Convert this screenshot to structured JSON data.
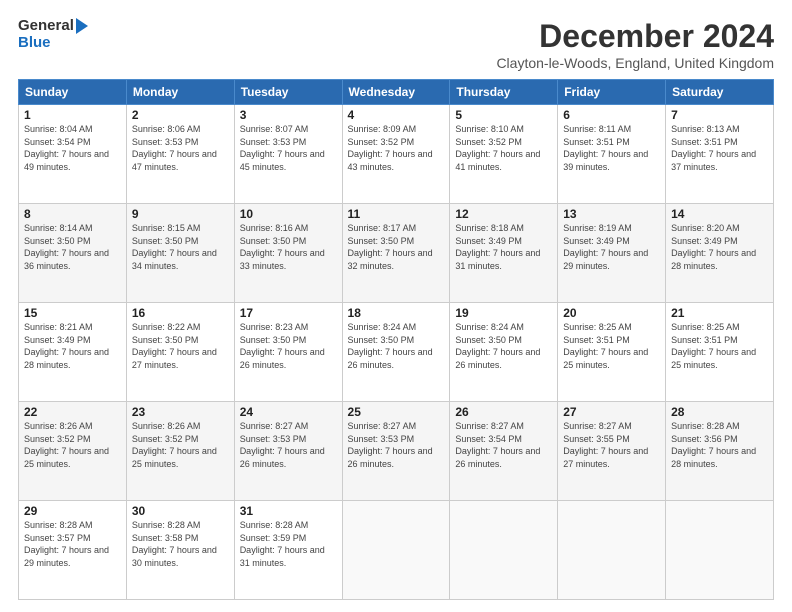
{
  "logo": {
    "line1": "General",
    "line2": "Blue"
  },
  "title": "December 2024",
  "location": "Clayton-le-Woods, England, United Kingdom",
  "days_of_week": [
    "Sunday",
    "Monday",
    "Tuesday",
    "Wednesday",
    "Thursday",
    "Friday",
    "Saturday"
  ],
  "weeks": [
    [
      {
        "day": "1",
        "sunrise": "Sunrise: 8:04 AM",
        "sunset": "Sunset: 3:54 PM",
        "daylight": "Daylight: 7 hours and 49 minutes."
      },
      {
        "day": "2",
        "sunrise": "Sunrise: 8:06 AM",
        "sunset": "Sunset: 3:53 PM",
        "daylight": "Daylight: 7 hours and 47 minutes."
      },
      {
        "day": "3",
        "sunrise": "Sunrise: 8:07 AM",
        "sunset": "Sunset: 3:53 PM",
        "daylight": "Daylight: 7 hours and 45 minutes."
      },
      {
        "day": "4",
        "sunrise": "Sunrise: 8:09 AM",
        "sunset": "Sunset: 3:52 PM",
        "daylight": "Daylight: 7 hours and 43 minutes."
      },
      {
        "day": "5",
        "sunrise": "Sunrise: 8:10 AM",
        "sunset": "Sunset: 3:52 PM",
        "daylight": "Daylight: 7 hours and 41 minutes."
      },
      {
        "day": "6",
        "sunrise": "Sunrise: 8:11 AM",
        "sunset": "Sunset: 3:51 PM",
        "daylight": "Daylight: 7 hours and 39 minutes."
      },
      {
        "day": "7",
        "sunrise": "Sunrise: 8:13 AM",
        "sunset": "Sunset: 3:51 PM",
        "daylight": "Daylight: 7 hours and 37 minutes."
      }
    ],
    [
      {
        "day": "8",
        "sunrise": "Sunrise: 8:14 AM",
        "sunset": "Sunset: 3:50 PM",
        "daylight": "Daylight: 7 hours and 36 minutes."
      },
      {
        "day": "9",
        "sunrise": "Sunrise: 8:15 AM",
        "sunset": "Sunset: 3:50 PM",
        "daylight": "Daylight: 7 hours and 34 minutes."
      },
      {
        "day": "10",
        "sunrise": "Sunrise: 8:16 AM",
        "sunset": "Sunset: 3:50 PM",
        "daylight": "Daylight: 7 hours and 33 minutes."
      },
      {
        "day": "11",
        "sunrise": "Sunrise: 8:17 AM",
        "sunset": "Sunset: 3:50 PM",
        "daylight": "Daylight: 7 hours and 32 minutes."
      },
      {
        "day": "12",
        "sunrise": "Sunrise: 8:18 AM",
        "sunset": "Sunset: 3:49 PM",
        "daylight": "Daylight: 7 hours and 31 minutes."
      },
      {
        "day": "13",
        "sunrise": "Sunrise: 8:19 AM",
        "sunset": "Sunset: 3:49 PM",
        "daylight": "Daylight: 7 hours and 29 minutes."
      },
      {
        "day": "14",
        "sunrise": "Sunrise: 8:20 AM",
        "sunset": "Sunset: 3:49 PM",
        "daylight": "Daylight: 7 hours and 28 minutes."
      }
    ],
    [
      {
        "day": "15",
        "sunrise": "Sunrise: 8:21 AM",
        "sunset": "Sunset: 3:49 PM",
        "daylight": "Daylight: 7 hours and 28 minutes."
      },
      {
        "day": "16",
        "sunrise": "Sunrise: 8:22 AM",
        "sunset": "Sunset: 3:50 PM",
        "daylight": "Daylight: 7 hours and 27 minutes."
      },
      {
        "day": "17",
        "sunrise": "Sunrise: 8:23 AM",
        "sunset": "Sunset: 3:50 PM",
        "daylight": "Daylight: 7 hours and 26 minutes."
      },
      {
        "day": "18",
        "sunrise": "Sunrise: 8:24 AM",
        "sunset": "Sunset: 3:50 PM",
        "daylight": "Daylight: 7 hours and 26 minutes."
      },
      {
        "day": "19",
        "sunrise": "Sunrise: 8:24 AM",
        "sunset": "Sunset: 3:50 PM",
        "daylight": "Daylight: 7 hours and 26 minutes."
      },
      {
        "day": "20",
        "sunrise": "Sunrise: 8:25 AM",
        "sunset": "Sunset: 3:51 PM",
        "daylight": "Daylight: 7 hours and 25 minutes."
      },
      {
        "day": "21",
        "sunrise": "Sunrise: 8:25 AM",
        "sunset": "Sunset: 3:51 PM",
        "daylight": "Daylight: 7 hours and 25 minutes."
      }
    ],
    [
      {
        "day": "22",
        "sunrise": "Sunrise: 8:26 AM",
        "sunset": "Sunset: 3:52 PM",
        "daylight": "Daylight: 7 hours and 25 minutes."
      },
      {
        "day": "23",
        "sunrise": "Sunrise: 8:26 AM",
        "sunset": "Sunset: 3:52 PM",
        "daylight": "Daylight: 7 hours and 25 minutes."
      },
      {
        "day": "24",
        "sunrise": "Sunrise: 8:27 AM",
        "sunset": "Sunset: 3:53 PM",
        "daylight": "Daylight: 7 hours and 26 minutes."
      },
      {
        "day": "25",
        "sunrise": "Sunrise: 8:27 AM",
        "sunset": "Sunset: 3:53 PM",
        "daylight": "Daylight: 7 hours and 26 minutes."
      },
      {
        "day": "26",
        "sunrise": "Sunrise: 8:27 AM",
        "sunset": "Sunset: 3:54 PM",
        "daylight": "Daylight: 7 hours and 26 minutes."
      },
      {
        "day": "27",
        "sunrise": "Sunrise: 8:27 AM",
        "sunset": "Sunset: 3:55 PM",
        "daylight": "Daylight: 7 hours and 27 minutes."
      },
      {
        "day": "28",
        "sunrise": "Sunrise: 8:28 AM",
        "sunset": "Sunset: 3:56 PM",
        "daylight": "Daylight: 7 hours and 28 minutes."
      }
    ],
    [
      {
        "day": "29",
        "sunrise": "Sunrise: 8:28 AM",
        "sunset": "Sunset: 3:57 PM",
        "daylight": "Daylight: 7 hours and 29 minutes."
      },
      {
        "day": "30",
        "sunrise": "Sunrise: 8:28 AM",
        "sunset": "Sunset: 3:58 PM",
        "daylight": "Daylight: 7 hours and 30 minutes."
      },
      {
        "day": "31",
        "sunrise": "Sunrise: 8:28 AM",
        "sunset": "Sunset: 3:59 PM",
        "daylight": "Daylight: 7 hours and 31 minutes."
      },
      null,
      null,
      null,
      null
    ]
  ]
}
